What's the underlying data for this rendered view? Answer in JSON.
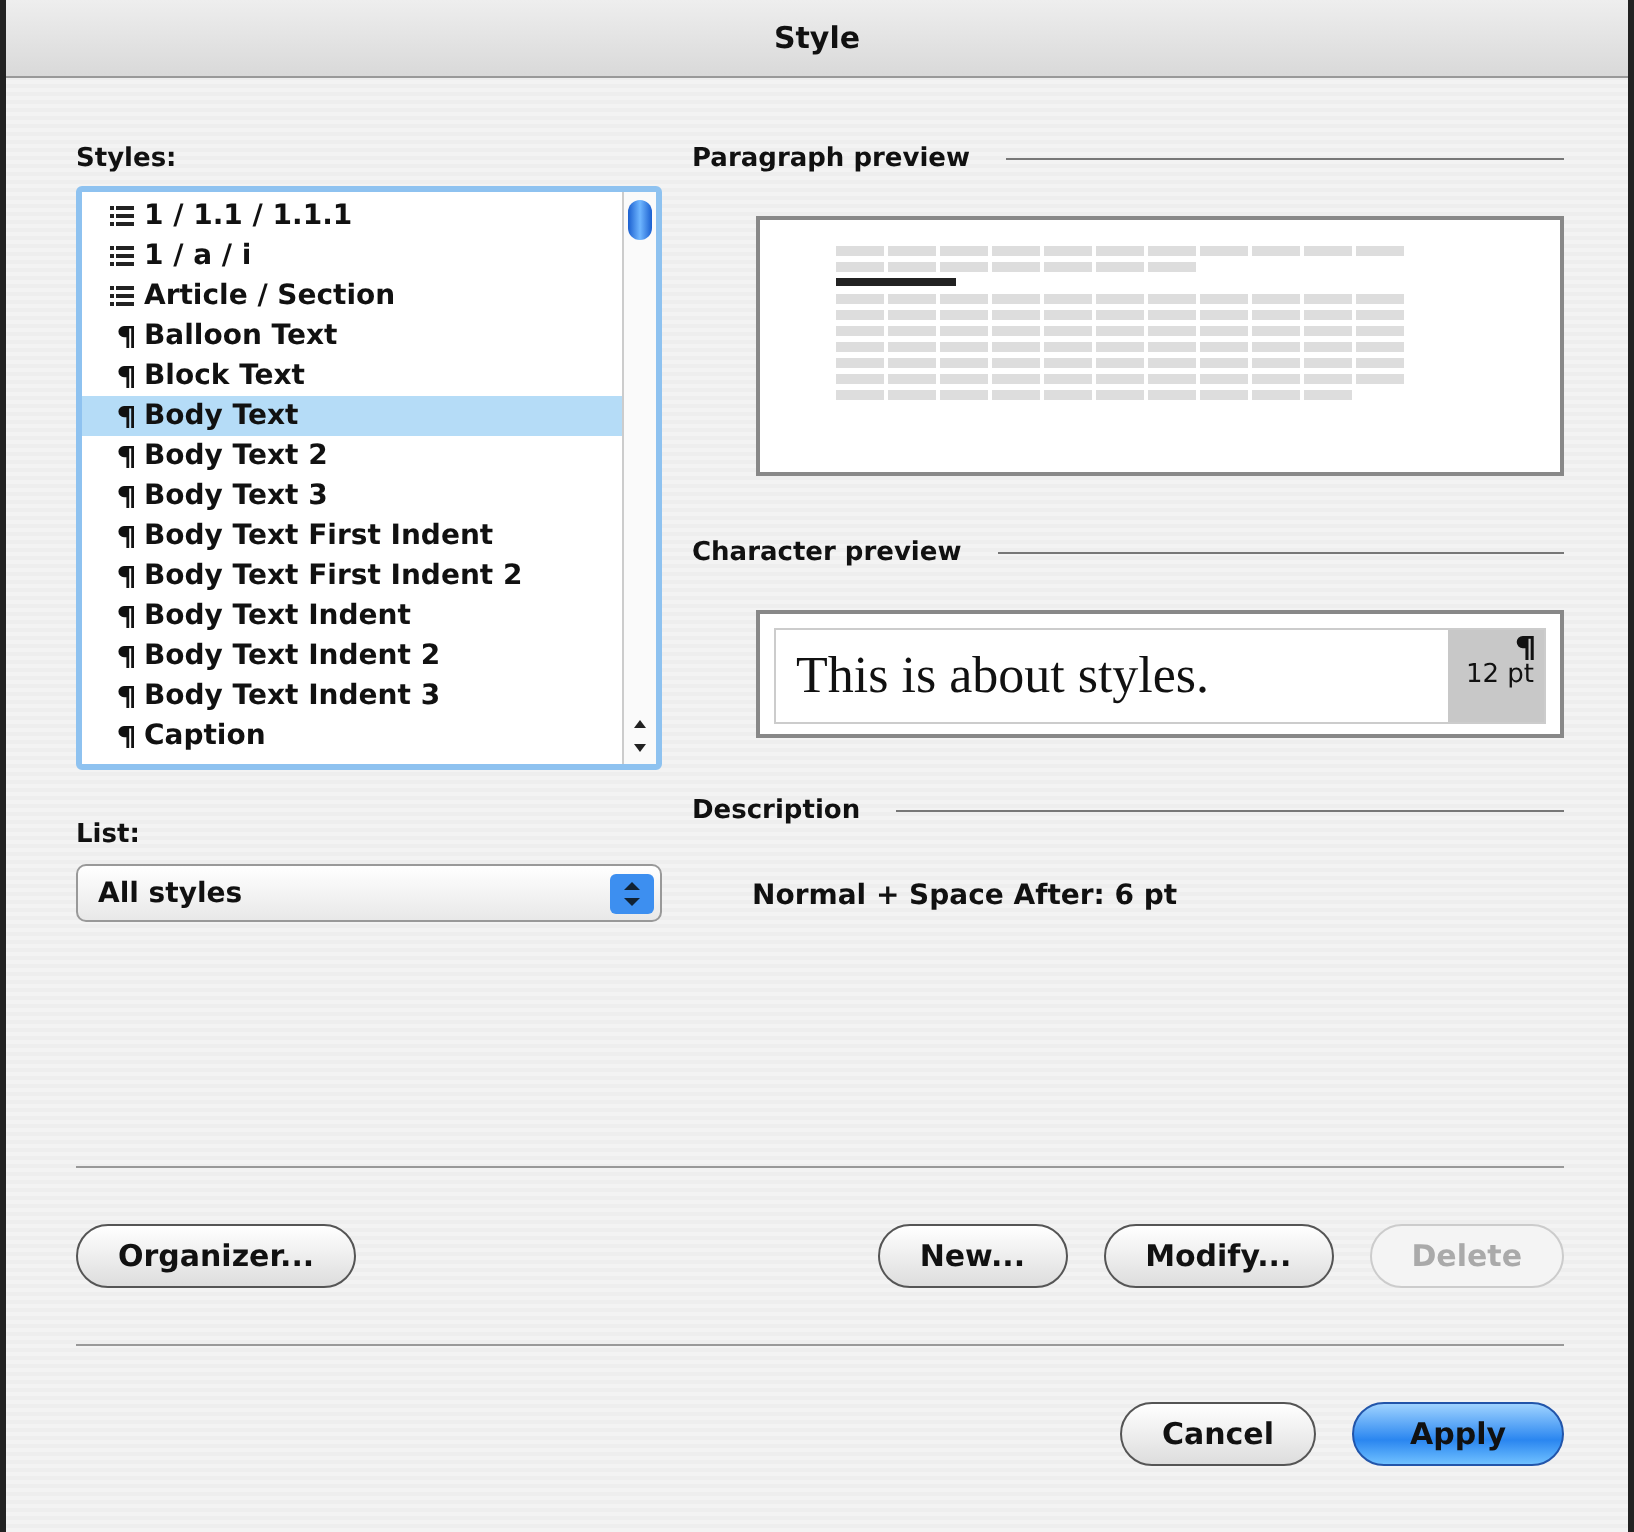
{
  "window": {
    "title": "Style"
  },
  "styles": {
    "label": "Styles:",
    "items": [
      {
        "kind": "list",
        "name": "1 / 1.1 / 1.1.1",
        "selected": false
      },
      {
        "kind": "list",
        "name": "1 / a / i",
        "selected": false
      },
      {
        "kind": "list",
        "name": "Article / Section",
        "selected": false
      },
      {
        "kind": "paragraph",
        "name": "Balloon Text",
        "selected": false
      },
      {
        "kind": "paragraph",
        "name": "Block Text",
        "selected": false
      },
      {
        "kind": "paragraph",
        "name": "Body Text",
        "selected": true
      },
      {
        "kind": "paragraph",
        "name": "Body Text 2",
        "selected": false
      },
      {
        "kind": "paragraph",
        "name": "Body Text 3",
        "selected": false
      },
      {
        "kind": "paragraph",
        "name": "Body Text First Indent",
        "selected": false
      },
      {
        "kind": "paragraph",
        "name": "Body Text First Indent 2",
        "selected": false
      },
      {
        "kind": "paragraph",
        "name": "Body Text Indent",
        "selected": false
      },
      {
        "kind": "paragraph",
        "name": "Body Text Indent 2",
        "selected": false
      },
      {
        "kind": "paragraph",
        "name": "Body Text Indent 3",
        "selected": false
      },
      {
        "kind": "paragraph",
        "name": "Caption",
        "selected": false
      }
    ]
  },
  "list": {
    "label": "List:",
    "value": "All styles"
  },
  "paragraph_preview": {
    "label": "Paragraph preview"
  },
  "character_preview": {
    "label": "Character preview",
    "sample": "This is about styles.",
    "size": "12 pt"
  },
  "description": {
    "label": "Description",
    "text": "Normal + Space After:  6 pt"
  },
  "buttons": [
    {
      "label": "Organizer...",
      "disabled": false,
      "default": false
    },
    {
      "label": "New...",
      "disabled": false,
      "default": false
    },
    {
      "label": "Modify...",
      "disabled": false,
      "default": false
    },
    {
      "label": "Delete",
      "disabled": true,
      "default": false
    }
  ],
  "footer_buttons": [
    {
      "label": "Cancel",
      "disabled": false,
      "default": false
    },
    {
      "label": "Apply",
      "disabled": false,
      "default": true
    }
  ]
}
